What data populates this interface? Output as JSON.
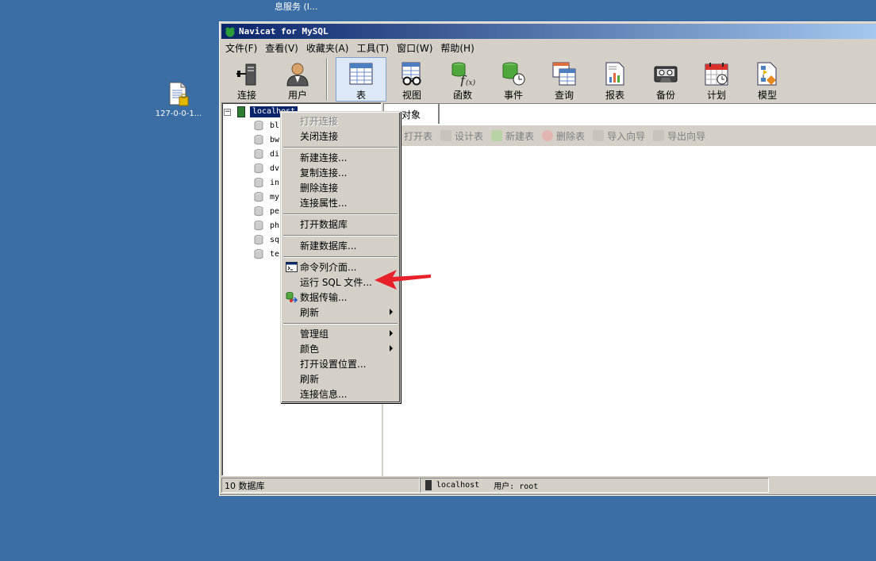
{
  "desktop": {
    "top_caption": "息服务 (I...",
    "icon_label": "127-0-0-1..."
  },
  "window": {
    "title": "Navicat for MySQL",
    "menu": [
      "文件(F)",
      "查看(V)",
      "收藏夹(A)",
      "工具(T)",
      "窗口(W)",
      "帮助(H)"
    ],
    "toolbar_left": [
      {
        "label": "连接",
        "icon": "plug-server-icon"
      },
      {
        "label": "用户",
        "icon": "user-icon"
      }
    ],
    "toolbar_right": [
      {
        "label": "表",
        "icon": "table-icon",
        "active": true
      },
      {
        "label": "视图",
        "icon": "view-glasses-icon"
      },
      {
        "label": "函数",
        "icon": "function-icon"
      },
      {
        "label": "事件",
        "icon": "event-clock-icon"
      },
      {
        "label": "查询",
        "icon": "query-icon"
      },
      {
        "label": "报表",
        "icon": "report-icon"
      },
      {
        "label": "备份",
        "icon": "backup-tape-icon"
      },
      {
        "label": "计划",
        "icon": "calendar-icon"
      },
      {
        "label": "模型",
        "icon": "model-icon"
      }
    ],
    "tree": {
      "root": "localhost",
      "databases": [
        "bl",
        "bw",
        "di",
        "dv",
        "in",
        "my",
        "pe",
        "ph",
        "sq",
        "te"
      ]
    },
    "tab_label": "对象",
    "object_toolbar": [
      "打开表",
      "设计表",
      "新建表",
      "删除表",
      "导入向导",
      "导出向导"
    ],
    "status": {
      "db_count": "10 数据库",
      "server": "localhost",
      "user": "用户: root"
    }
  },
  "context_menu": {
    "items": [
      {
        "label": "打开连接",
        "disabled": true
      },
      {
        "label": "关闭连接"
      },
      {
        "sep": true
      },
      {
        "label": "新建连接..."
      },
      {
        "label": "复制连接..."
      },
      {
        "label": "删除连接"
      },
      {
        "label": "连接属性..."
      },
      {
        "sep": true
      },
      {
        "label": "打开数据库"
      },
      {
        "sep": true
      },
      {
        "label": "新建数据库..."
      },
      {
        "sep": true
      },
      {
        "label": "命令列介面...",
        "icon": "console-icon"
      },
      {
        "label": "运行 SQL 文件..."
      },
      {
        "label": "数据传输...",
        "icon": "data-transfer-icon"
      },
      {
        "label": "刷新",
        "submenu": true
      },
      {
        "sep": true
      },
      {
        "label": "管理组",
        "submenu": true
      },
      {
        "label": "颜色",
        "submenu": true
      },
      {
        "label": "打开设置位置..."
      },
      {
        "label": "刷新"
      },
      {
        "label": "连接信息..."
      }
    ]
  },
  "colors": {
    "desktop": "#3a6ea5",
    "titlebar_start": "#0a246a",
    "titlebar_end": "#a6caf0",
    "annotation_arrow": "#e8202a"
  }
}
